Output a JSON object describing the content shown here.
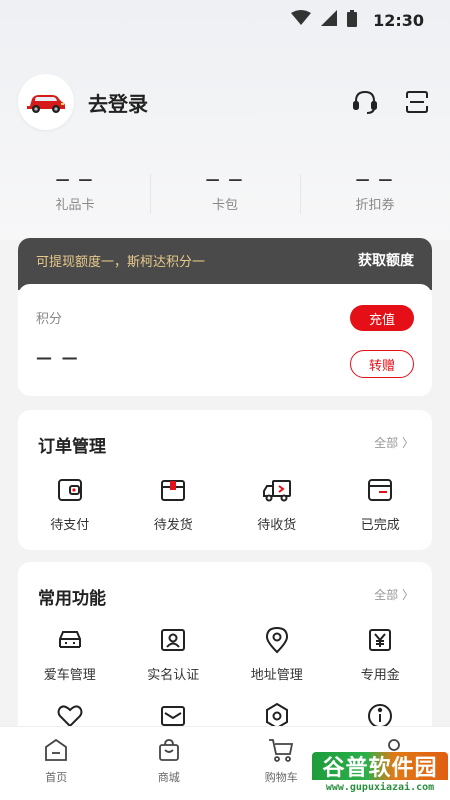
{
  "status_bar": {
    "time": "12:30"
  },
  "header": {
    "login_label": "去登录"
  },
  "stats": [
    {
      "value": "— —",
      "label": "礼品卡"
    },
    {
      "value": "— —",
      "label": "卡包"
    },
    {
      "value": "— —",
      "label": "折扣券"
    }
  ],
  "points_banner": {
    "promo_text": "可提现额度一，斯柯达积分一",
    "get_quota_label": "获取额度"
  },
  "points_card": {
    "label": "积分",
    "value": "— —",
    "recharge_label": "充值",
    "transfer_label": "转赠"
  },
  "orders": {
    "title": "订单管理",
    "more_label": "全部 〉",
    "items": [
      {
        "label": "待支付",
        "icon": "wallet-icon"
      },
      {
        "label": "待发货",
        "icon": "package-icon"
      },
      {
        "label": "待收货",
        "icon": "truck-icon"
      },
      {
        "label": "已完成",
        "icon": "box-complete-icon"
      }
    ]
  },
  "functions": {
    "title": "常用功能",
    "more_label": "全部 〉",
    "items": [
      {
        "label": "爱车管理",
        "icon": "car-icon"
      },
      {
        "label": "实名认证",
        "icon": "id-card-icon"
      },
      {
        "label": "地址管理",
        "icon": "location-icon"
      },
      {
        "label": "专用金",
        "icon": "yen-icon"
      },
      {
        "label": "",
        "icon": "heart-icon"
      },
      {
        "label": "",
        "icon": "mail-icon"
      },
      {
        "label": "",
        "icon": "settings-icon"
      },
      {
        "label": "",
        "icon": "info-icon"
      }
    ]
  },
  "bottom_nav": [
    {
      "label": "首页",
      "icon": "home-icon"
    },
    {
      "label": "商城",
      "icon": "shopping-bag-icon"
    },
    {
      "label": "购物车",
      "icon": "cart-icon"
    },
    {
      "label": "",
      "icon": "profile-icon"
    }
  ],
  "watermark": {
    "main": "谷普软件园",
    "sub": "www.gupuxiazai.com"
  },
  "colors": {
    "accent": "#e50f17",
    "banner_bg": "#4a4a4a",
    "banner_text": "#e8c98b"
  }
}
